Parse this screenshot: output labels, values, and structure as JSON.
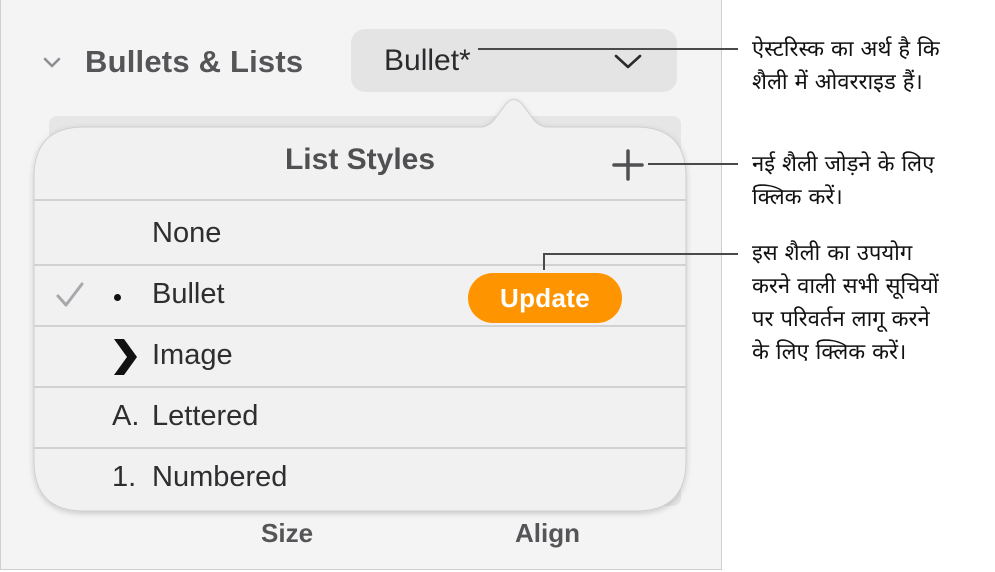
{
  "inspector": {
    "section_title": "Bullets & Lists",
    "list_style_popup": {
      "value": "Bullet*"
    },
    "bottom_labels": {
      "size": "Size",
      "align": "Align"
    }
  },
  "popover": {
    "title": "List Styles",
    "add_icon": "plus-icon",
    "styles": [
      {
        "label": "None",
        "prefix": "",
        "selected": false
      },
      {
        "label": "Bullet",
        "prefix": "•",
        "selected": true,
        "update_label": "Update"
      },
      {
        "label": "Image",
        "prefix": "chevron-right-icon",
        "selected": false
      },
      {
        "label": "Lettered",
        "prefix": "A.",
        "selected": false
      },
      {
        "label": "Numbered",
        "prefix": "1.",
        "selected": false
      }
    ]
  },
  "callouts": {
    "asterisk": {
      "line1": "ऐस्टरिस्क का अर्थ है कि",
      "line2": "शैली में ओवरराइड हैं।"
    },
    "add": {
      "line1": "नई शैली जोड़ने के लिए",
      "line2": "क्लिक करें।"
    },
    "update": {
      "line1": "इस शैली का उपयोग",
      "line2": "करने वाली सभी सूचियों",
      "line3": "पर परिवर्तन लागू करने",
      "line4": "के लिए क्लिक करें।"
    }
  },
  "colors": {
    "accent": "#fe9500",
    "panel_bg": "#f4f4f4",
    "popover_bg": "#f1f1f1"
  }
}
